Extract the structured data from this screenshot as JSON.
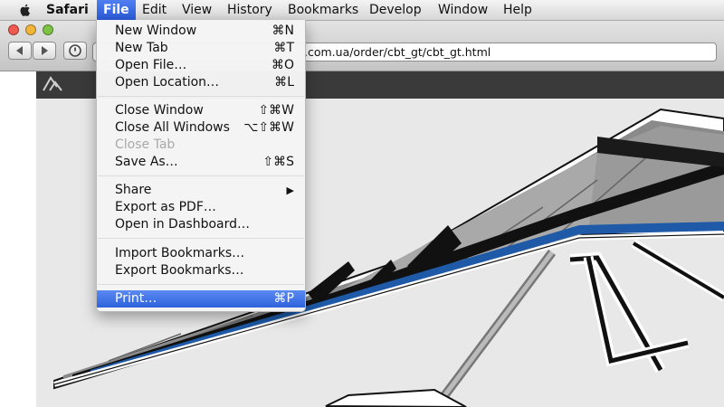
{
  "menubar": {
    "apple_icon": "apple-icon",
    "items": [
      {
        "label": "Safari"
      },
      {
        "label": "File"
      },
      {
        "label": "Edit"
      },
      {
        "label": "View"
      },
      {
        "label": "History"
      },
      {
        "label": "Bookmarks"
      },
      {
        "label": "Develop"
      },
      {
        "label": "Window"
      },
      {
        "label": "Help"
      }
    ],
    "active_item": "File",
    "highlight_color": "#2f66dd"
  },
  "toolbar": {
    "traffic_lights": [
      "#ee5a50",
      "#f1b53a",
      "#7dc244"
    ],
    "back_icon": "back-arrow-icon",
    "forward_icon": "forward-arrow-icon",
    "reader_icon": "clock-icon",
    "url_visible_text": ".com.ua/order/cbt_gt/cbt_gt.html"
  },
  "file_menu": {
    "items": [
      {
        "label": "New Window",
        "shortcut": "⌘N"
      },
      {
        "label": "New Tab",
        "shortcut": "⌘T"
      },
      {
        "label": "Open File…",
        "shortcut": "⌘O"
      },
      {
        "label": "Open Location…",
        "shortcut": "⌘L"
      },
      {
        "label": "Close Window",
        "shortcut": "⇧⌘W"
      },
      {
        "label": "Close All Windows",
        "shortcut": "⌥⇧⌘W"
      },
      {
        "label": "Close Tab",
        "shortcut": "",
        "disabled": true
      },
      {
        "label": "Save As…",
        "shortcut": "⇧⌘S"
      },
      {
        "label": "Share",
        "shortcut": "▶",
        "submenu": true
      },
      {
        "label": "Export as PDF…",
        "shortcut": ""
      },
      {
        "label": "Open in Dashboard…",
        "shortcut": ""
      },
      {
        "label": "Import Bookmarks…",
        "shortcut": ""
      },
      {
        "label": "Export Bookmarks…",
        "shortcut": ""
      },
      {
        "label": "Print…",
        "shortcut": "⌘P",
        "selected": true
      }
    ]
  },
  "page": {
    "logo_icon": "site-logo-icon",
    "glider_colors": {
      "sail": "#8a8a8a",
      "dark": "#111111",
      "stripe": "#1e5aa8",
      "frame": "#ffffff"
    }
  }
}
